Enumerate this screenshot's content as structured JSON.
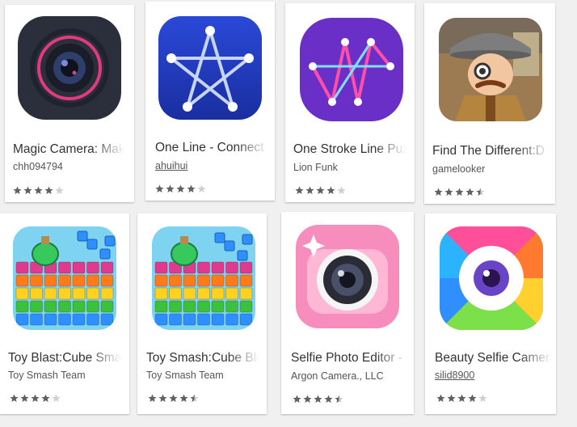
{
  "apps": [
    {
      "title": "Magic Camera: Makeup",
      "developer": "chh094794",
      "developer_link": false,
      "rating": 4.0
    },
    {
      "title": "One Line - Connect",
      "developer": "ahuihui",
      "developer_link": true,
      "rating": 4.0
    },
    {
      "title": "One Stroke Line Puzzle",
      "developer": "Lion Funk",
      "developer_link": false,
      "rating": 4.0
    },
    {
      "title": "Find The Different:D",
      "developer": "gamelooker",
      "developer_link": false,
      "rating": 4.5
    },
    {
      "title": "Toy Blast:Cube Smash",
      "developer": "Toy Smash Team",
      "developer_link": false,
      "rating": 4.0
    },
    {
      "title": "Toy Smash:Cube Blast",
      "developer": "Toy Smash Team",
      "developer_link": false,
      "rating": 4.5
    },
    {
      "title": "Selfie Photo Editor -",
      "developer": "Argon Camera., LLC",
      "developer_link": false,
      "rating": 4.5
    },
    {
      "title": "Beauty Selfie Camera",
      "developer": "silid8900",
      "developer_link": true,
      "rating": 4.0
    }
  ],
  "colors": {
    "star_filled": "#616161",
    "star_empty": "#d0d0d0"
  },
  "icons": [
    "camera-lens-icon",
    "star-line-icon",
    "m-line-icon",
    "detective-icon",
    "cube-blast-icon",
    "cube-blast-icon",
    "pink-camera-icon",
    "aperture-icon"
  ]
}
